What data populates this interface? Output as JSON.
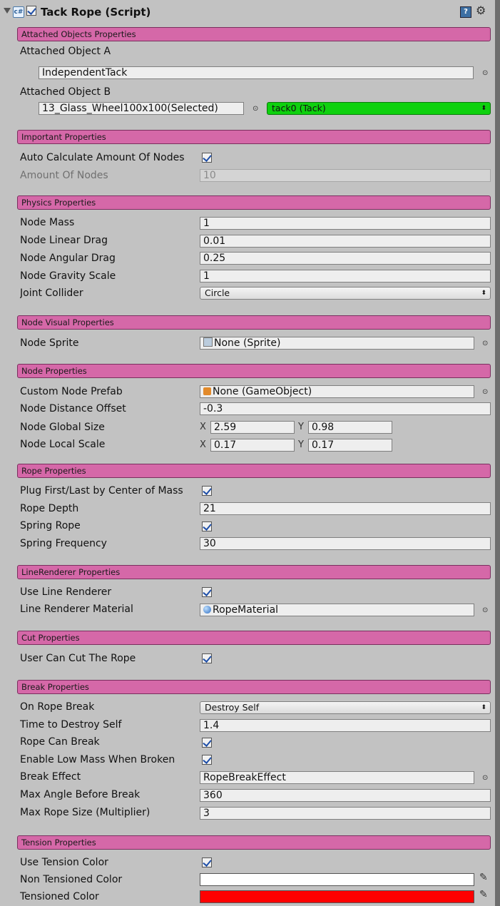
{
  "component": {
    "title": "Tack Rope (Script)",
    "icon": "csharp-script-icon",
    "enabled": true
  },
  "sections": {
    "attached": "Attached Objects Properties",
    "important": "Important Properties",
    "physics": "Physics Properties",
    "visual": "Node Visual Properties",
    "node": "Node Properties",
    "rope": "Rope Properties",
    "line": "LineRenderer Properties",
    "cut": "Cut Properties",
    "break": "Break Properties",
    "tension": "Tension Properties"
  },
  "attached": {
    "a_label": "Attached Object A",
    "a_value": "IndependentTack",
    "b_label": "Attached Object B",
    "b_value": "13_Glass_Wheel100x100(Selected)",
    "b_dropdown": "tack0 (Tack)"
  },
  "important": {
    "auto_label": "Auto Calculate Amount Of Nodes",
    "auto_checked": true,
    "amount_label": "Amount Of Nodes",
    "amount_value": "10"
  },
  "physics": {
    "mass_label": "Node Mass",
    "mass_value": "1",
    "linear_label": "Node Linear Drag",
    "linear_value": "0.01",
    "angular_label": "Node Angular Drag",
    "angular_value": "0.25",
    "gravity_label": "Node Gravity Scale",
    "gravity_value": "1",
    "collider_label": "Joint Collider",
    "collider_value": "Circle"
  },
  "visual": {
    "sprite_label": "Node Sprite",
    "sprite_value": "None (Sprite)"
  },
  "node": {
    "prefab_label": "Custom Node Prefab",
    "prefab_value": "None (GameObject)",
    "offset_label": "Node Distance Offset",
    "offset_value": "-0.3",
    "global_label": "Node Global Size",
    "global_x": "2.59",
    "global_y": "0.98",
    "local_label": "Node Local Scale",
    "local_x": "0.17",
    "local_y": "0.17",
    "x_letter": "X",
    "y_letter": "Y"
  },
  "rope": {
    "plug_label": "Plug First/Last by Center of Mass",
    "plug_checked": true,
    "depth_label": "Rope Depth",
    "depth_value": "21",
    "spring_label": "Spring Rope",
    "spring_checked": true,
    "freq_label": "Spring Frequency",
    "freq_value": "30"
  },
  "line": {
    "use_label": "Use Line Renderer",
    "use_checked": true,
    "material_label": "Line Renderer Material",
    "material_value": "RopeMaterial"
  },
  "cut": {
    "cut_label": "User Can Cut The Rope",
    "cut_checked": true
  },
  "break": {
    "on_label": "On Rope Break",
    "on_value": "Destroy Self",
    "time_label": "Time to Destroy Self",
    "time_value": "1.4",
    "can_label": "Rope Can Break",
    "can_checked": true,
    "low_label": "Enable Low Mass When Broken",
    "low_checked": true,
    "effect_label": "Break Effect",
    "effect_value": "RopeBreakEffect",
    "angle_label": "Max Angle Before Break",
    "angle_value": "360",
    "size_label": "Max Rope Size (Multiplier)",
    "size_value": "3"
  },
  "tension": {
    "use_label": "Use Tension Color",
    "use_checked": true,
    "non_label": "Non Tensioned Color",
    "non_color": "#ffffff",
    "ten_label": "Tensioned Color",
    "ten_color": "#ff0000"
  },
  "colors": {
    "section_header": "#d568a8",
    "dropdown_green": "#0ed10e",
    "panel": "#c2c2c2"
  }
}
